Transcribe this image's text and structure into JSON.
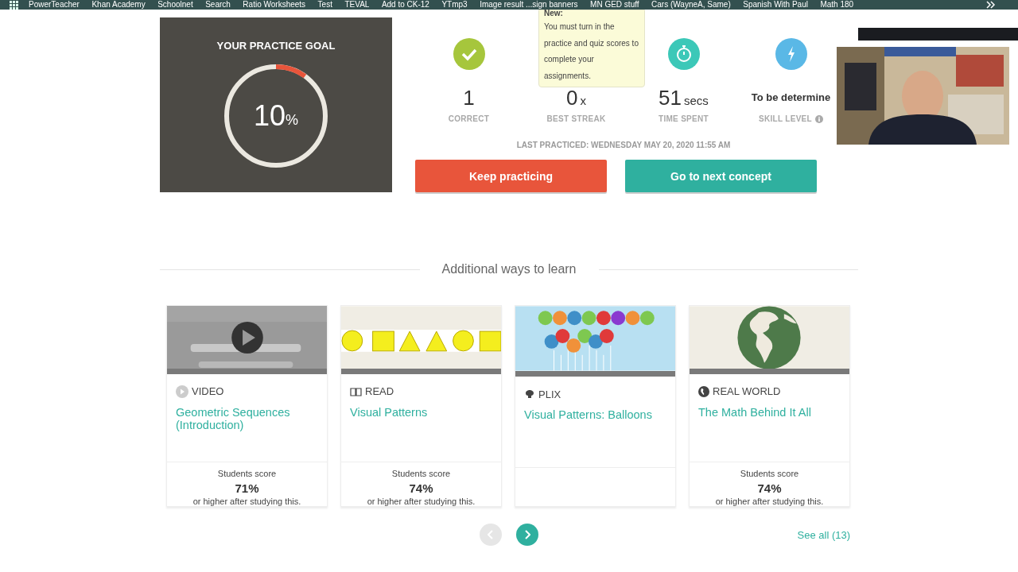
{
  "bookmarks": [
    "PowerTeacher",
    "Khan Academy",
    "Schoolnet",
    "Search",
    "Ratio Worksheets",
    "Test",
    "TEVAL",
    "Add to CK-12",
    "YTmp3",
    "Image result ...sign banners",
    "MN GED stuff",
    "Cars (WayneA, Same)",
    "Spanish With Paul",
    "Math 180"
  ],
  "goal": {
    "title": "YOUR PRACTICE GOAL",
    "value": "10",
    "unit": "%",
    "level": 0.1
  },
  "stats": [
    {
      "kind": "correct",
      "value": "1",
      "label": "CORRECT"
    },
    {
      "kind": "streak",
      "value": "0",
      "unit": "x",
      "label": "BEST STREAK"
    },
    {
      "kind": "time",
      "value": "51",
      "unit": "secs",
      "label": "TIME SPENT"
    },
    {
      "kind": "skill",
      "value": "To be determine",
      "label": "SKILL LEVEL"
    }
  ],
  "tooltip": {
    "heading": "New:",
    "text": "You must turn in the practice and quiz scores to complete your assignments."
  },
  "last_practiced": "LAST PRACTICED: WEDNESDAY MAY 20, 2020 11:55 AM",
  "buttons": [
    {
      "label": "Keep practicing",
      "kind": "primary"
    },
    {
      "label": "Go to next concept",
      "kind": "secondary"
    }
  ],
  "section_title": "Additional ways to learn",
  "cards": [
    {
      "kind": "video",
      "type": "VIDEO",
      "title": "Geometric Sequences (Introduction)",
      "score": {
        "label": "Students score",
        "value": "71%",
        "note": "or higher after studying this."
      }
    },
    {
      "kind": "read",
      "type": "READ",
      "title": "Visual Patterns",
      "score": {
        "label": "Students score",
        "value": "74%",
        "note": "or higher after studying this."
      }
    },
    {
      "kind": "plix",
      "type": "PLIX",
      "title": "Visual Patterns: Balloons"
    },
    {
      "kind": "realworld",
      "type": "REAL WORLD",
      "title": "The Math Behind It All",
      "score": {
        "label": "Students score",
        "value": "74%",
        "note": "or higher after studying this."
      }
    }
  ],
  "pagination": {
    "prev_disabled": true,
    "next_disabled": false
  },
  "see_all": "See all (13)"
}
